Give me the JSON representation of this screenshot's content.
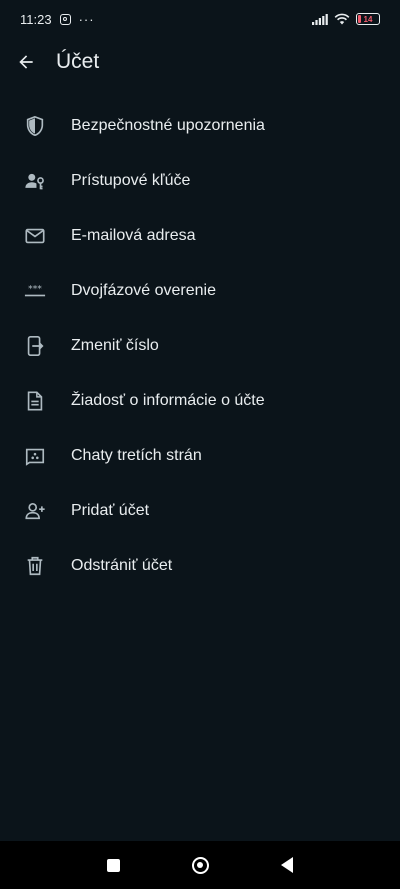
{
  "status_bar": {
    "time": "11:23",
    "more": "···",
    "battery_level": "14",
    "battery_color": "#f15c6d"
  },
  "header": {
    "title": "Účet",
    "back_icon": "arrow-left-icon"
  },
  "menu": {
    "items": [
      {
        "label": "Bezpečnostné upozornenia",
        "icon": "shield-icon"
      },
      {
        "label": "Prístupové kľúče",
        "icon": "person-key-icon"
      },
      {
        "label": "E-mailová adresa",
        "icon": "mail-icon"
      },
      {
        "label": "Dvojfázové overenie",
        "icon": "password-dots-icon"
      },
      {
        "label": "Zmeniť číslo",
        "icon": "phone-transfer-icon"
      },
      {
        "label": "Žiadosť o informácie o účte",
        "icon": "document-icon"
      },
      {
        "label": "Chaty tretích strán",
        "icon": "third-party-chat-icon"
      },
      {
        "label": "Pridať účet",
        "icon": "add-person-icon"
      },
      {
        "label": "Odstrániť účet",
        "icon": "trash-icon"
      }
    ]
  },
  "colors": {
    "background": "#0b141a",
    "text": "#e9edef",
    "icon": "#aebac1"
  }
}
